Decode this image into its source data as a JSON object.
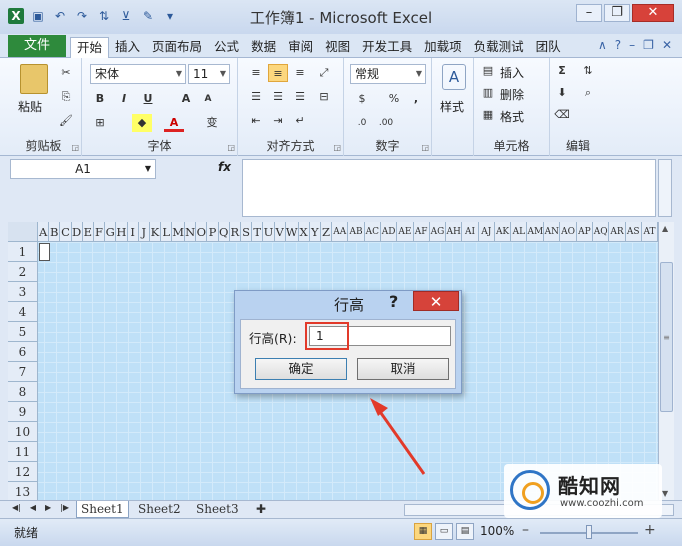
{
  "window": {
    "title": "工作簿1 - Microsoft Excel",
    "qat_icons": [
      "excel-logo-icon",
      "save-icon",
      "undo-icon",
      "redo-icon",
      "sort-asc-icon",
      "filter-icon",
      "format-painter-icon",
      "customize-qat-icon"
    ],
    "controls": {
      "minimize": "–",
      "restore": "❐",
      "close": "✕"
    }
  },
  "ribbon_tabs": {
    "file": "文件",
    "tabs": [
      "开始",
      "插入",
      "页面布局",
      "公式",
      "数据",
      "审阅",
      "视图",
      "开发工具",
      "加载项",
      "负载测试",
      "团队"
    ],
    "active": "开始"
  },
  "ribbon": {
    "clipboard": {
      "paste": "粘贴",
      "label": "剪贴板"
    },
    "font": {
      "name": "宋体",
      "size": "11",
      "bold": "B",
      "italic": "I",
      "underline": "U",
      "grow": "A",
      "shrink": "A",
      "phonetic": "变",
      "label": "字体"
    },
    "alignment": {
      "label": "对齐方式"
    },
    "number": {
      "format": "常规",
      "percent": "%",
      "comma": ",",
      "label": "数字"
    },
    "styles": {
      "label": "样式"
    },
    "cells": {
      "insert": "插入",
      "delete": "删除",
      "format": "格式",
      "label": "单元格"
    },
    "editing": {
      "sum": "Σ",
      "label": "编辑"
    }
  },
  "formula_bar": {
    "name_box": "A1",
    "fx": "fx",
    "content": ""
  },
  "sheet": {
    "columns": [
      "A",
      "B",
      "C",
      "D",
      "E",
      "F",
      "G",
      "H",
      "I",
      "J",
      "K",
      "L",
      "M",
      "N",
      "O",
      "P",
      "Q",
      "R",
      "S",
      "T",
      "U",
      "V",
      "W",
      "X",
      "Y",
      "Z",
      "AA",
      "AB",
      "AC",
      "AD",
      "AE",
      "AF",
      "AG",
      "AH",
      "AI",
      "AJ",
      "AK",
      "AL",
      "AM",
      "AN",
      "AO",
      "AP",
      "AQ",
      "AR",
      "AS",
      "AT"
    ],
    "rows": [
      "1",
      "2",
      "3",
      "4",
      "5",
      "6",
      "7",
      "8",
      "9",
      "10",
      "11",
      "12",
      "13"
    ]
  },
  "sheet_tabs": [
    "Sheet1",
    "Sheet2",
    "Sheet3"
  ],
  "active_sheet": "Sheet1",
  "status_bar": {
    "ready": "就绪",
    "zoom": "100%",
    "zoom_minus": "–",
    "zoom_plus": "+"
  },
  "dialog": {
    "title": "行高",
    "help": "?",
    "close": "✕",
    "label": "行高(R):",
    "value": "1",
    "ok": "确定",
    "cancel": "取消"
  },
  "watermark": {
    "name": "酷知网",
    "url": "www.coozhi.com"
  },
  "colors": {
    "sheet_bg": "#bfe0f7",
    "file_tab": "#2e8a3c",
    "close_red": "#d6433a",
    "highlight": "#e23a2a"
  }
}
